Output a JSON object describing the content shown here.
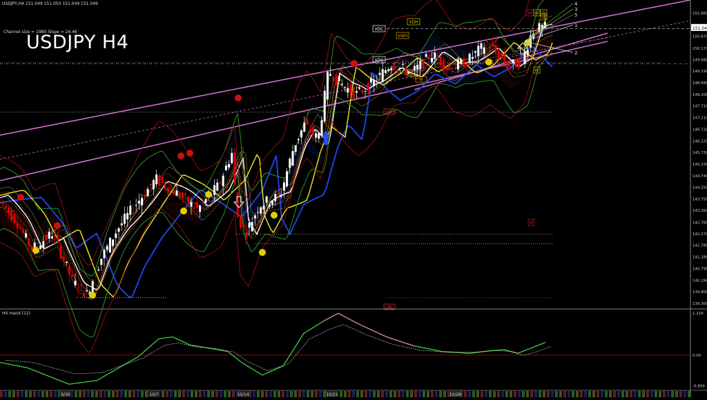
{
  "header": {
    "symbol_line": "USDJPY,H4  151.049 151.050 151.049 151.049",
    "channel_info": "Channel size = 1980 Slope = 24.46",
    "big_title": "USDJPY H4",
    "macd_label": "H4  macd (12)"
  },
  "chart_data": {
    "type": "candlestick",
    "title": "USDJPY H4",
    "price_axis_ticks": [
      "151.660",
      "151.049",
      "150.670",
      "150.170",
      "149.680",
      "149.190",
      "148.690",
      "148.200",
      "147.710",
      "147.210",
      "146.720",
      "146.220",
      "145.730",
      "145.230",
      "144.740",
      "144.250",
      "143.750",
      "143.260",
      "142.760",
      "142.270",
      "141.780",
      "141.280",
      "140.790",
      "140.290",
      "139.800",
      "139.300"
    ],
    "current_price": "151.049",
    "ylim": [
      139.1,
      152.1
    ],
    "macd_axis_ticks": [
      "1.216",
      "0.00",
      "-0.899"
    ],
    "macd_ylim": [
      -0.95,
      1.25
    ],
    "date_labels": [
      "9/30",
      "10/7",
      "10/14",
      "10/21",
      "10/28"
    ],
    "box_labels": [
      "VDC",
      "VDH",
      "VWH",
      "VDC",
      "VDL",
      "W",
      "W",
      "D",
      "W",
      "D",
      "M"
    ],
    "level_labels": [
      "LWL",
      "LML",
      "M"
    ],
    "fib_labels": [
      "4",
      "3",
      "5",
      "1",
      "2"
    ],
    "trend": "uptrend from ~139.6 to ~151.0"
  },
  "colors": {
    "background": "#000000",
    "bull_candle": "#ffffff",
    "bear_candle": "#e00000",
    "channel": "#d070d0",
    "yellow_ma": "#e0e020",
    "blue_ma": "#2040e0",
    "green_band": "#30a030",
    "macd_main": "#40d040",
    "macd_neg": "#d08090"
  }
}
